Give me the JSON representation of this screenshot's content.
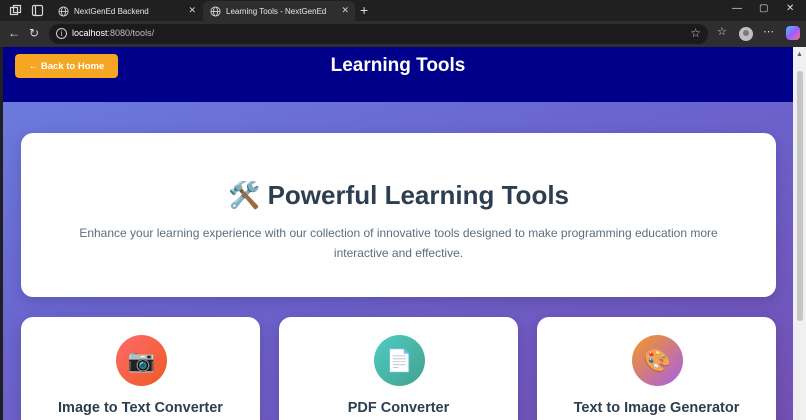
{
  "browser": {
    "tabs": [
      {
        "title": "NextGenEd Backend",
        "active": false
      },
      {
        "title": "Learning Tools - NextGenEd",
        "active": true
      }
    ],
    "close_glyph": "✕",
    "new_tab_glyph": "+",
    "url_host": "localhost",
    "url_path": ":8080/tools/",
    "window_controls": [
      "—",
      "▢",
      "✕"
    ]
  },
  "page": {
    "back_label": "← Back to Home",
    "title": "Learning Tools",
    "hero": {
      "icon": "🛠️",
      "title": "Powerful Learning Tools",
      "description": "Enhance your learning experience with our collection of innovative tools designed to make programming education more interactive and effective."
    },
    "tools": [
      {
        "icon": "📷",
        "title": "Image to Text Converter",
        "color_from": "#ff6b6b",
        "color_to": "#ee5a24"
      },
      {
        "icon": "📄",
        "title": "PDF Converter",
        "color_from": "#4ecdc4",
        "color_to": "#44a08d"
      },
      {
        "icon": "🎨",
        "title": "Text to Image Generator",
        "color_from": "#f7971e",
        "color_to": "#a55eea"
      }
    ]
  },
  "colors": {
    "header_bg": "#00008b",
    "back_button": "#f5a623",
    "gradient_start": "#6b7fe0",
    "gradient_end": "#7350b4"
  }
}
